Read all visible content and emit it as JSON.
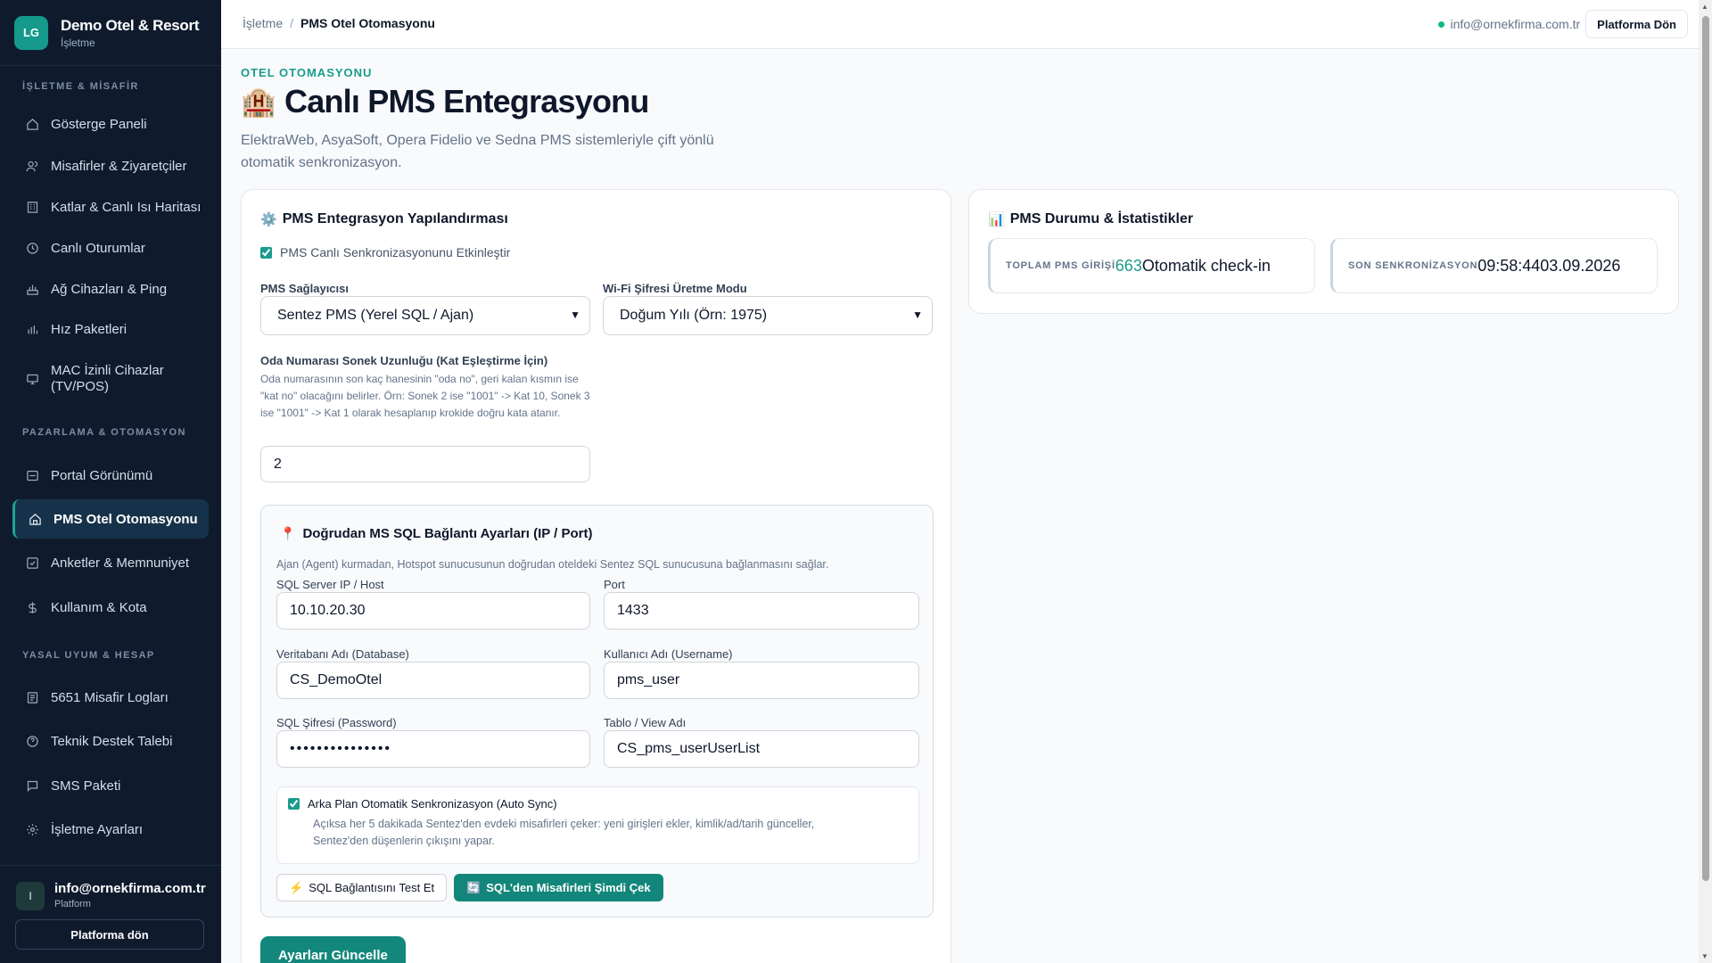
{
  "brand": {
    "logo": "LG",
    "name": "Demo Otel & Resort",
    "subtitle": "İşletme"
  },
  "sidebar": {
    "sections": [
      "İŞLETME & MİSAFİR",
      "PAZARLAMA & OTOMASYON",
      "YASAL UYUM & HESAP"
    ],
    "items": [
      {
        "label": "Gösterge Paneli",
        "icon": "home-icon"
      },
      {
        "label": "Misafirler & Ziyaretçiler",
        "icon": "users-icon"
      },
      {
        "label": "Katlar & Canlı Isı Haritası",
        "icon": "building-icon"
      },
      {
        "label": "Canlı Oturumlar",
        "icon": "clock-icon"
      },
      {
        "label": "Ağ Cihazları & Ping",
        "icon": "network-icon"
      },
      {
        "label": "Hız Paketleri",
        "icon": "bars-icon"
      },
      {
        "label": "MAC İzinli Cihazlar (TV/POS)",
        "icon": "monitor-icon"
      },
      {
        "label": "Portal Görünümü",
        "icon": "layout-icon"
      },
      {
        "label": "PMS Otel Otomasyonu",
        "icon": "hotel-icon",
        "active": true
      },
      {
        "label": "Anketler & Memnuniyet",
        "icon": "check-square-icon"
      },
      {
        "label": "Kullanım & Kota",
        "icon": "dollar-icon"
      },
      {
        "label": "5651 Misafir Logları",
        "icon": "log-icon"
      },
      {
        "label": "Teknik Destek Talebi",
        "icon": "help-icon"
      },
      {
        "label": "SMS Paketi",
        "icon": "message-icon"
      },
      {
        "label": "İşletme Ayarları",
        "icon": "gear-icon"
      }
    ],
    "user": {
      "avatar": "I",
      "email": "info@ornekfirma.com.tr",
      "role": "Platform"
    },
    "footer_button": "Platforma dön"
  },
  "topbar": {
    "breadcrumb": [
      "İşletme",
      "PMS Otel Otomasyonu"
    ],
    "separator": "/",
    "email": "info@ornekfirma.com.tr",
    "button": "Platforma Dön"
  },
  "page": {
    "eyebrow": "OTEL OTOMASYONU",
    "title_icon": "🏨",
    "title": "Canlı PMS Entegrasyonu",
    "description": "ElektraWeb, AsyaSoft, Opera Fidelio ve Sedna PMS sistemleriyle çift yönlü otomatik senkronizasyon."
  },
  "config": {
    "title_icon": "⚙️",
    "title": "PMS Entegrasyon Yapılandırması",
    "enable_sync_label": "PMS Canlı Senkronizasyonunu Etkinleştir",
    "enable_sync_checked": true,
    "provider_label": "PMS Sağlayıcısı",
    "provider_value": "Sentez PMS (Yerel SQL / Ajan)",
    "wifi_label": "Wi-Fi Şifresi Üretme Modu",
    "wifi_value": "Doğum Yılı (Örn: 1975)",
    "suffix_label": "Oda Numarası Sonek Uzunluğu (Kat Eşleştirme İçin)",
    "suffix_help": "Oda numarasının son kaç hanesinin \"oda no\", geri kalan kısmın ise \"kat no\" olacağını belirler. Örn: Sonek 2 ise \"1001\" -> Kat 10, Sonek 3 ise \"1001\" -> Kat 1 olarak hesaplanıp krokide doğru kata atanır.",
    "suffix_value": "2",
    "update_button": "Ayarları Güncelle"
  },
  "sql": {
    "title_icon": "📍",
    "title": "Doğrudan MS SQL Bağlantı Ayarları (IP / Port)",
    "description": "Ajan (Agent) kurmadan, Hotspot sunucusunun doğrudan oteldeki Sentez SQL sunucusuna bağlanmasını sağlar.",
    "host_label": "SQL Server IP / Host",
    "host_value": "10.10.20.30",
    "port_label": "Port",
    "port_value": "1433",
    "db_label": "Veritabanı Adı (Database)",
    "db_value": "CS_DemoOtel",
    "user_label": "Kullanıcı Adı (Username)",
    "user_value": "pms_user",
    "pass_label": "SQL Şifresi (Password)",
    "pass_value": "•••••••••••••••",
    "table_label": "Tablo / View Adı",
    "table_value": "CS_pms_userUserList",
    "autosync_label": "Arka Plan Otomatik Senkronizasyon (Auto Sync)",
    "autosync_checked": true,
    "autosync_help": "Açıksa her 5 dakikada Sentez'den evdeki misafirleri çeker: yeni girişleri ekler, kimlik/ad/tarih günceller, Sentez'den düşenlerin çıkışını yapar.",
    "test_button": "SQL Bağlantısını Test Et",
    "test_icon": "⚡",
    "fetch_button": "SQL'den Misafirleri Şimdi Çek",
    "fetch_icon": "🔄"
  },
  "status": {
    "title_icon": "📊",
    "title": "PMS Durumu & İstatistikler",
    "total_label": "TOPLAM PMS GİRİŞİ",
    "total_value": "663",
    "total_suffix": "Otomatik check-in",
    "last_label": "SON SENKRONİZASYON",
    "last_value": "09:58:4403.09.2026"
  },
  "colors": {
    "accent": "#1a9c8c",
    "sidebar_bg": "#0f1b2d",
    "status_online": "#10b981"
  }
}
